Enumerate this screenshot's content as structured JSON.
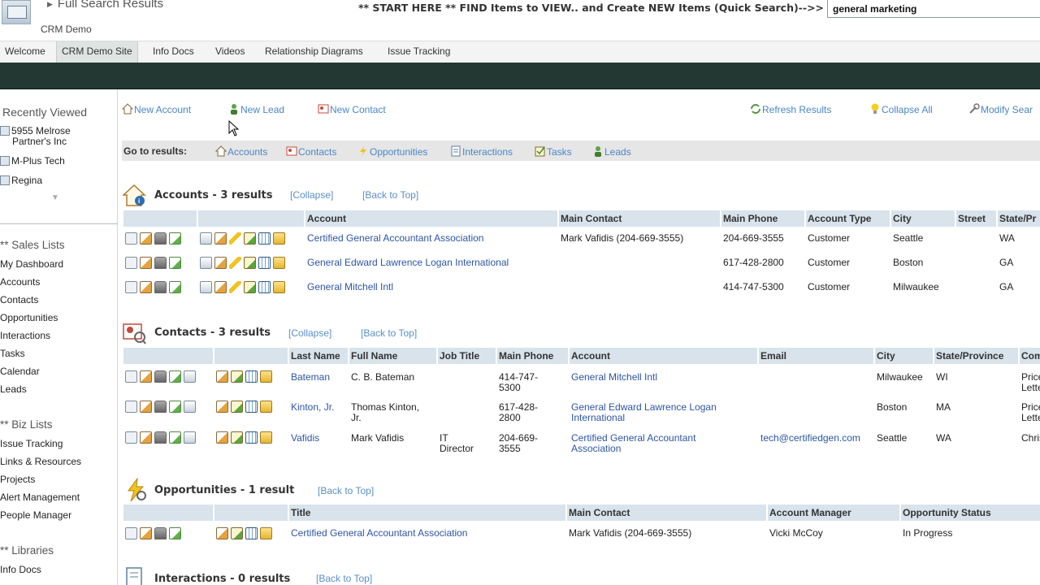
{
  "header": {
    "breadcrumb": "Full Search Results",
    "site_name": "CRM Demo",
    "quick_search_label": "** START HERE ** FIND Items to VIEW.. and Create NEW Items (Quick Search)-->>",
    "quick_search_value": "general marketing"
  },
  "nav": {
    "tabs": [
      {
        "label": "Welcome"
      },
      {
        "label": "CRM Demo Site"
      },
      {
        "label": "Info Docs"
      },
      {
        "label": "Videos"
      },
      {
        "label": "Relationship Diagrams"
      },
      {
        "label": "Issue Tracking"
      }
    ]
  },
  "left": {
    "recently_viewed_title": "Recently Viewed",
    "recent": [
      {
        "label1": "5955 Melrose",
        "label2": "Partner's Inc"
      },
      {
        "label1": "M-Plus Tech"
      },
      {
        "label1": "Regina"
      }
    ],
    "sales_title": "** Sales Lists",
    "sales_links": [
      "My Dashboard",
      "Accounts",
      "Contacts",
      "Opportunities",
      "Interactions",
      "Tasks",
      "Calendar",
      "Leads"
    ],
    "biz_title": "** Biz Lists",
    "biz_links": [
      "Issue Tracking",
      "Links & Resources",
      "Projects",
      "Alert Management",
      "People Manager"
    ],
    "lib_title": "** Libraries",
    "lib_links": [
      "Info Docs"
    ]
  },
  "actions": {
    "new_account": "New Account",
    "new_lead": "New Lead",
    "new_contact": "New Contact",
    "refresh": "Refresh Results",
    "collapse_all": "Collapse All",
    "modify": "Modify Sear"
  },
  "goto": {
    "label": "Go to results:",
    "links": [
      "Accounts",
      "Contacts",
      "Opportunities",
      "Interactions",
      "Tasks",
      "Leads"
    ]
  },
  "accounts": {
    "title": "Accounts - 3 results",
    "collapse": "[Collapse]",
    "back": "[Back to Top]",
    "columns": [
      "Account",
      "Main Contact",
      "Main Phone",
      "Account Type",
      "City",
      "Street",
      "State/Pr"
    ],
    "rows": [
      [
        "Certified General Accountant Association",
        "Mark Vafidis (204-669-3555)",
        "204-669-3555",
        "Customer",
        "Seattle",
        "",
        "WA"
      ],
      [
        "General Edward Lawrence Logan International",
        "",
        "617-428-2800",
        "Customer",
        "Boston",
        "",
        "GA"
      ],
      [
        "General Mitchell Intl",
        "",
        "414-747-5300",
        "Customer",
        "Milwaukee",
        "",
        "GA"
      ]
    ]
  },
  "contacts": {
    "title": "Contacts - 3 results",
    "collapse": "[Collapse]",
    "back": "[Back to Top]",
    "columns": [
      "Last Name",
      "Full Name",
      "Job Title",
      "Main Phone",
      "Account",
      "Email",
      "City",
      "State/Province",
      "Comm"
    ],
    "rows": [
      {
        "last": "Bateman",
        "full1": "C. B. Bateman",
        "full2": "",
        "job1": "",
        "job2": "",
        "phone1": "414-747-",
        "phone2": "5300",
        "acct1": "General Mitchell Intl",
        "acct2": "",
        "email": "",
        "city": "Milwaukee",
        "state": "WI",
        "comm1": "Price I",
        "comm2": "Letter"
      },
      {
        "last": "Kinton, Jr.",
        "full1": "Thomas Kinton,",
        "full2": "Jr.",
        "job1": "",
        "job2": "",
        "phone1": "617-428-",
        "phone2": "2800",
        "acct1": "General Edward Lawrence Logan",
        "acct2": "International",
        "email": "",
        "city": "Boston",
        "state": "MA",
        "comm1": "Price I",
        "comm2": "Letter"
      },
      {
        "last": "Vafidis",
        "full1": "Mark Vafidis",
        "full2": "",
        "job1": "IT",
        "job2": "Director",
        "phone1": "204-669-",
        "phone2": "3555",
        "acct1": "Certified General Accountant",
        "acct2": "Association",
        "email": "tech@certifiedgen.com",
        "city": "Seattle",
        "state": "WA",
        "comm1": "Christ",
        "comm2": ""
      }
    ]
  },
  "opportunities": {
    "title": "Opportunities - 1 result",
    "back": "[Back to Top]",
    "columns": [
      "Title",
      "Main Contact",
      "Account Manager",
      "Opportunity Status"
    ],
    "rows": [
      [
        "Certified General Accountant Association",
        "Mark Vafidis (204-669-3555)",
        "Vicki McCoy",
        "In Progress"
      ]
    ]
  },
  "interactions": {
    "title": "Interactions - 0 results",
    "back": "[Back to Top]"
  }
}
